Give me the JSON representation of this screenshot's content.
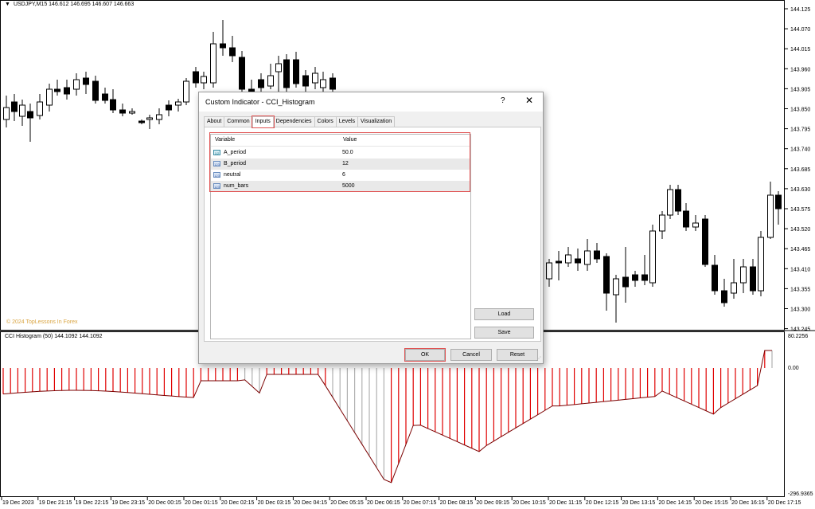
{
  "chart": {
    "symbol_line": "USDJPY,M15  146.612 146.695 146.607 146.663",
    "indicator_line": "CCI Histogram (50) 144.1092 144.1092",
    "watermark": "© 2024 TopLessons In Forex",
    "price_axis": [
      "144.125",
      "144.070",
      "144.015",
      "143.960",
      "143.905",
      "143.850",
      "143.795",
      "143.740",
      "143.685",
      "143.630",
      "143.575",
      "143.520",
      "143.465",
      "143.410",
      "143.355",
      "143.300",
      "143.245"
    ],
    "ind_axis_top": "80.2256",
    "ind_axis_zero": "0.00",
    "ind_axis_bottom": "-296.9365",
    "time_axis": [
      "19 Dec 2023",
      "19 Dec 21:15",
      "19 Dec 22:15",
      "19 Dec 23:15",
      "20 Dec 00:15",
      "20 Dec 01:15",
      "20 Dec 02:15",
      "20 Dec 03:15",
      "20 Dec 04:15",
      "20 Dec 05:15",
      "20 Dec 06:15",
      "20 Dec 07:15",
      "20 Dec 08:15",
      "20 Dec 09:15",
      "20 Dec 10:15",
      "20 Dec 11:15",
      "20 Dec 12:15",
      "20 Dec 13:15",
      "20 Dec 14:15",
      "20 Dec 15:15",
      "20 Dec 16:15",
      "20 Dec 17:15"
    ],
    "colors": {
      "bull": "#ffffff",
      "bear": "#000000",
      "hist_neg": "#e00000",
      "hist_light": "#b0b0b0",
      "hist_line": "#7a0000"
    }
  },
  "dialog": {
    "title": "Custom Indicator - CCI_Histogram",
    "help": "?",
    "close": "✕",
    "tabs": [
      "About",
      "Common",
      "Inputs",
      "Dependencies",
      "Colors",
      "Levels",
      "Visualization"
    ],
    "active_tab": "Inputs",
    "table": {
      "col_variable": "Variable",
      "col_value": "Value",
      "rows": [
        {
          "icon": "double-icon",
          "icon_text": "1/2",
          "name": "A_period",
          "value": "50.0"
        },
        {
          "icon": "int-icon",
          "icon_text": "123",
          "name": "B_period",
          "value": "12"
        },
        {
          "icon": "int-icon",
          "icon_text": "123",
          "name": "neutral",
          "value": "6"
        },
        {
          "icon": "int-icon",
          "icon_text": "123",
          "name": "num_bars",
          "value": "5000"
        }
      ]
    },
    "buttons": {
      "load": "Load",
      "save": "Save",
      "ok": "OK",
      "cancel": "Cancel",
      "reset": "Reset"
    }
  }
}
